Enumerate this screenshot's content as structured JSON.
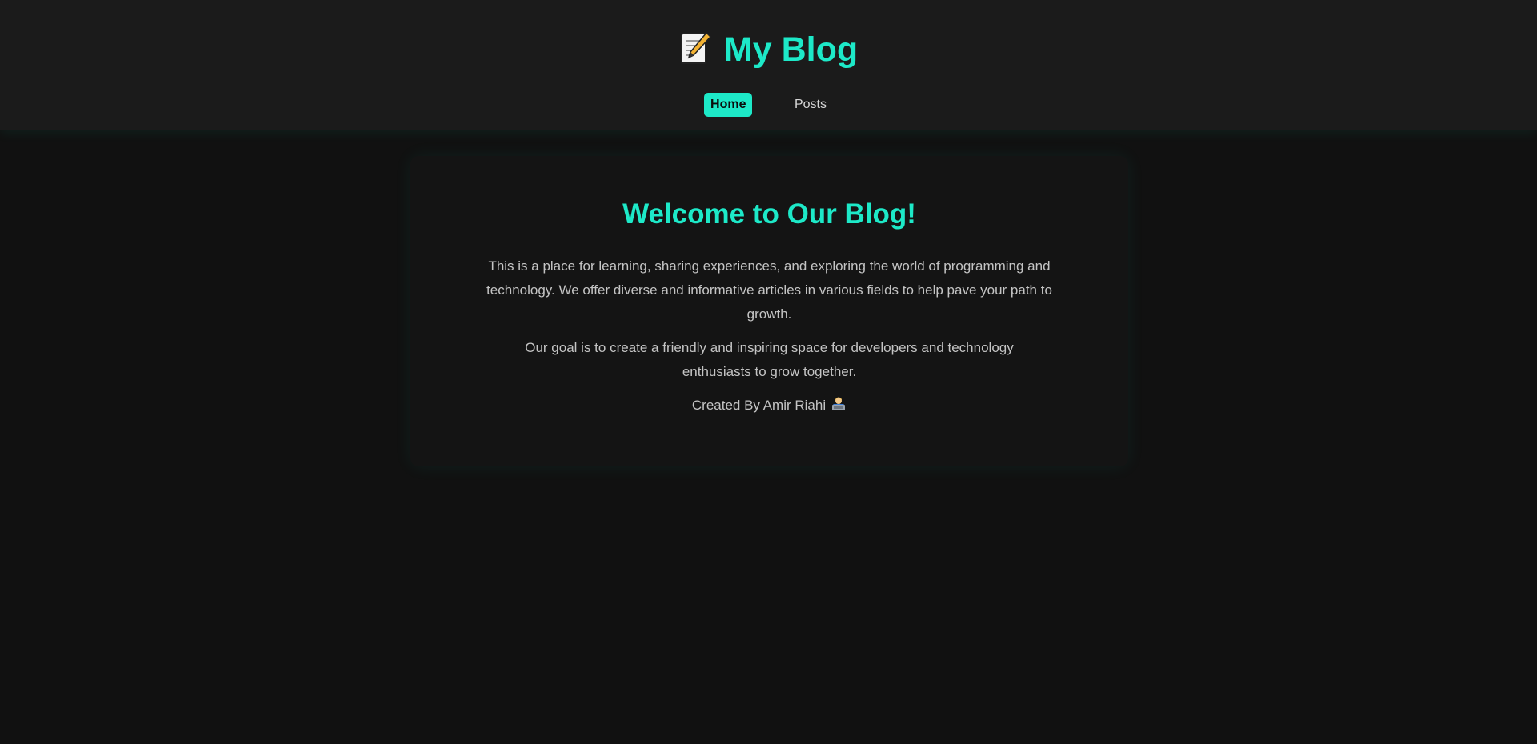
{
  "header": {
    "title": "My Blog",
    "title_icon": "memo-icon",
    "nav": [
      {
        "label": "Home",
        "active": true
      },
      {
        "label": "Posts",
        "active": false
      }
    ]
  },
  "main": {
    "heading": "Welcome to Our Blog!",
    "paragraphs": [
      "This is a place for learning, sharing experiences, and exploring the world of programming and technology. We offer diverse and informative articles in various fields to help pave your path to growth.",
      "Our goal is to create a friendly and inspiring space for developers and technology enthusiasts to grow together."
    ],
    "credit": "Created By Amir Riahi",
    "credit_icon": "technologist-icon"
  },
  "colors": {
    "accent": "#1de9c8",
    "page_bg": "#111111",
    "header_bg": "#1b1b1b",
    "card_bg": "#141414",
    "text": "#c4c4c4"
  }
}
